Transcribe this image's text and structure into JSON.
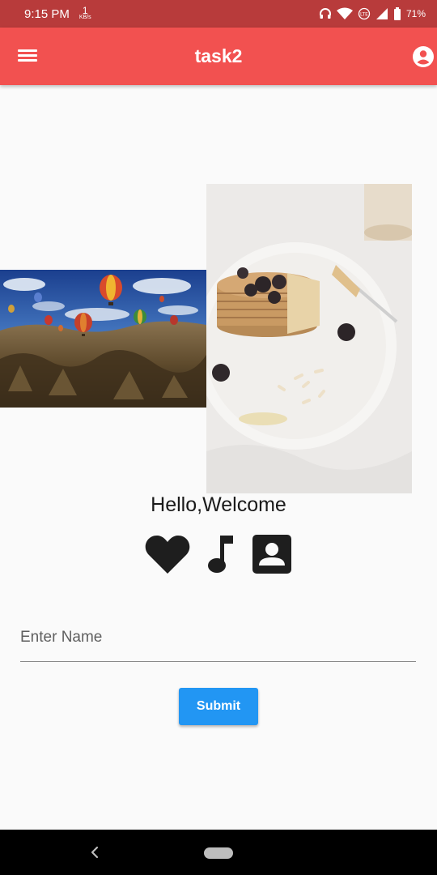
{
  "status_bar": {
    "time": "9:15 PM",
    "net_speed_value": "1",
    "net_speed_unit": "KB/s",
    "battery": "71%"
  },
  "app_bar": {
    "title": "task2",
    "menu_icon": "hamburger-menu-icon",
    "account_icon": "account-circle-icon"
  },
  "content": {
    "image_left": "hot-air-balloons-landscape",
    "image_right": "pancakes-with-berries",
    "welcome_text": "Hello,Welcome",
    "icons": [
      "heart-icon",
      "music-note-icon",
      "contact-card-icon"
    ],
    "name_field": {
      "placeholder": "Enter Name",
      "value": ""
    },
    "submit_label": "Submit"
  },
  "nav_bar": {
    "back_icon": "back-chevron-icon",
    "home_icon": "home-pill-icon"
  },
  "colors": {
    "status_bar": "#b83b3b",
    "app_bar": "#f25150",
    "button": "#2296f3",
    "background": "#fafafa"
  }
}
